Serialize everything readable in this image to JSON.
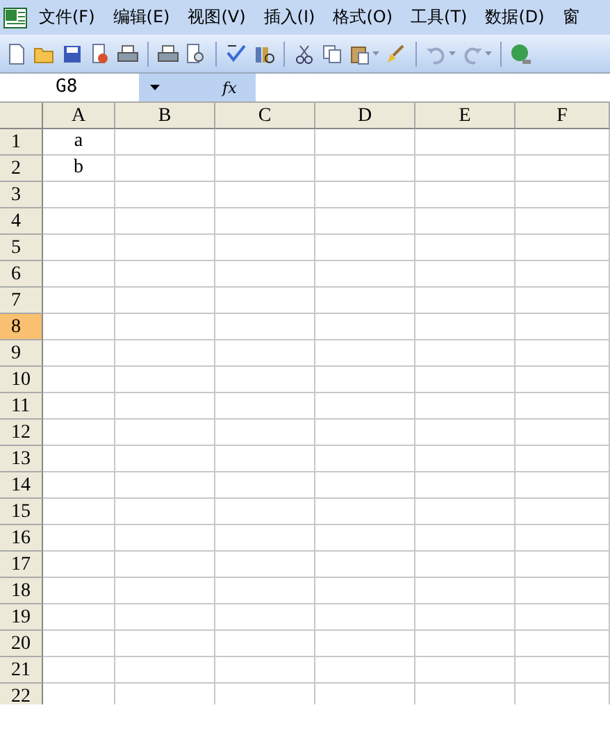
{
  "menu_bar": {
    "items": [
      "文件(F)",
      "编辑(E)",
      "视图(V)",
      "插入(I)",
      "格式(O)",
      "工具(T)",
      "数据(D)",
      "窗"
    ]
  },
  "toolbar": {
    "buttons": [
      {
        "kind": "new"
      },
      {
        "kind": "open"
      },
      {
        "kind": "save"
      },
      {
        "kind": "permission"
      },
      {
        "kind": "print"
      },
      {
        "kind": "sep"
      },
      {
        "kind": "print"
      },
      {
        "kind": "preview"
      },
      {
        "kind": "sep"
      },
      {
        "kind": "spell"
      },
      {
        "kind": "research"
      },
      {
        "kind": "sep"
      },
      {
        "kind": "cut"
      },
      {
        "kind": "copy"
      },
      {
        "kind": "paste"
      },
      {
        "kind": "dropdown"
      },
      {
        "kind": "brush"
      },
      {
        "kind": "sep"
      },
      {
        "kind": "undo"
      },
      {
        "kind": "dropdown"
      },
      {
        "kind": "redo"
      },
      {
        "kind": "dropdown"
      },
      {
        "kind": "sep"
      },
      {
        "kind": "globe"
      }
    ]
  },
  "formula_bar": {
    "name_box": "G8",
    "fx": "fx"
  },
  "sheet": {
    "columns": [
      "A",
      "B",
      "C",
      "D",
      "E",
      "F"
    ],
    "rows": [
      {
        "label": "1",
        "selected": false,
        "cells": [
          "a"
        ]
      },
      {
        "label": "2",
        "selected": false,
        "cells": [
          "b"
        ]
      },
      {
        "label": "3",
        "selected": false,
        "cells": []
      },
      {
        "label": "4",
        "selected": false,
        "cells": []
      },
      {
        "label": "5",
        "selected": false,
        "cells": []
      },
      {
        "label": "6",
        "selected": false,
        "cells": []
      },
      {
        "label": "7",
        "selected": false,
        "cells": []
      },
      {
        "label": "8",
        "selected": true,
        "cells": []
      },
      {
        "label": "9",
        "selected": false,
        "cells": []
      },
      {
        "label": "10",
        "selected": false,
        "cells": []
      },
      {
        "label": "11",
        "selected": false,
        "cells": []
      },
      {
        "label": "12",
        "selected": false,
        "cells": []
      },
      {
        "label": "13",
        "selected": false,
        "cells": []
      },
      {
        "label": "14",
        "selected": false,
        "cells": []
      },
      {
        "label": "15",
        "selected": false,
        "cells": []
      },
      {
        "label": "16",
        "selected": false,
        "cells": []
      },
      {
        "label": "17",
        "selected": false,
        "cells": []
      },
      {
        "label": "18",
        "selected": false,
        "cells": []
      },
      {
        "label": "19",
        "selected": false,
        "cells": []
      },
      {
        "label": "20",
        "selected": false,
        "cells": []
      },
      {
        "label": "21",
        "selected": false,
        "cells": []
      },
      {
        "label": "22",
        "selected": false,
        "cells": []
      }
    ]
  }
}
